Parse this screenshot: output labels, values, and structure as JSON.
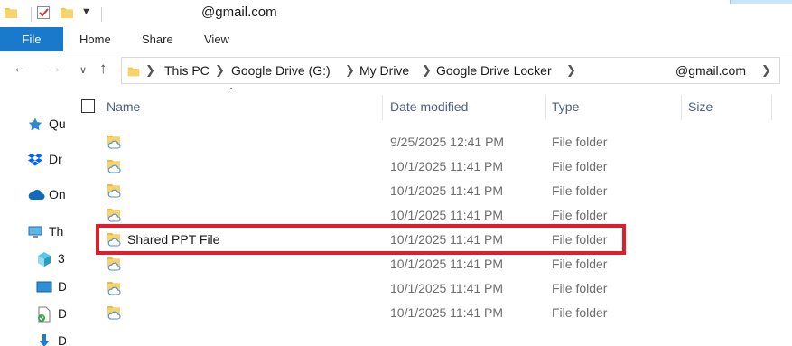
{
  "window": {
    "title": "@gmail.com"
  },
  "ribbon": {
    "tabs": [
      {
        "label": "File",
        "active": true
      },
      {
        "label": "Home"
      },
      {
        "label": "Share"
      },
      {
        "label": "View"
      }
    ]
  },
  "address": {
    "breadcrumbs": [
      "This PC",
      "Google Drive (G:)",
      "My Drive",
      "Google Drive Locker",
      "@gmail.com"
    ]
  },
  "navpane": {
    "items": [
      {
        "label": "Qu",
        "icon": "star-icon"
      },
      {
        "label": "Dr",
        "icon": "dropbox-icon"
      },
      {
        "label": "On",
        "icon": "onedrive-cloud-icon"
      },
      {
        "label": "Th",
        "icon": "computer-icon"
      },
      {
        "label": "3",
        "icon": "3d-objects-icon"
      },
      {
        "label": "D",
        "icon": "desktop-icon"
      },
      {
        "label": "D",
        "icon": "documents-icon"
      },
      {
        "label": "D",
        "icon": "downloads-icon"
      }
    ]
  },
  "columns": {
    "name": "Name",
    "date_modified": "Date modified",
    "type": "Type",
    "size": "Size"
  },
  "files": [
    {
      "name": "",
      "date": "9/25/2025 12:41 PM",
      "type": "File folder"
    },
    {
      "name": "",
      "date": "10/1/2025 11:41 PM",
      "type": "File folder"
    },
    {
      "name": "",
      "date": "10/1/2025 11:41 PM",
      "type": "File folder"
    },
    {
      "name": "",
      "date": "10/1/2025 11:41 PM",
      "type": "File folder"
    },
    {
      "name": "Shared PPT File",
      "date": "10/1/2025 11:41 PM",
      "type": "File folder",
      "highlighted": true
    },
    {
      "name": "",
      "date": "10/1/2025 11:41 PM",
      "type": "File folder"
    },
    {
      "name": "",
      "date": "10/1/2025 11:41 PM",
      "type": "File folder"
    },
    {
      "name": "",
      "date": "10/1/2025 11:41 PM",
      "type": "File folder"
    }
  ],
  "colors": {
    "file_tab": "#1979ca",
    "highlight": "#e01e2b",
    "header_text": "#4d6082",
    "folder_yellow": "#f7d36b",
    "cloud_blue": "#4a8fd4"
  }
}
